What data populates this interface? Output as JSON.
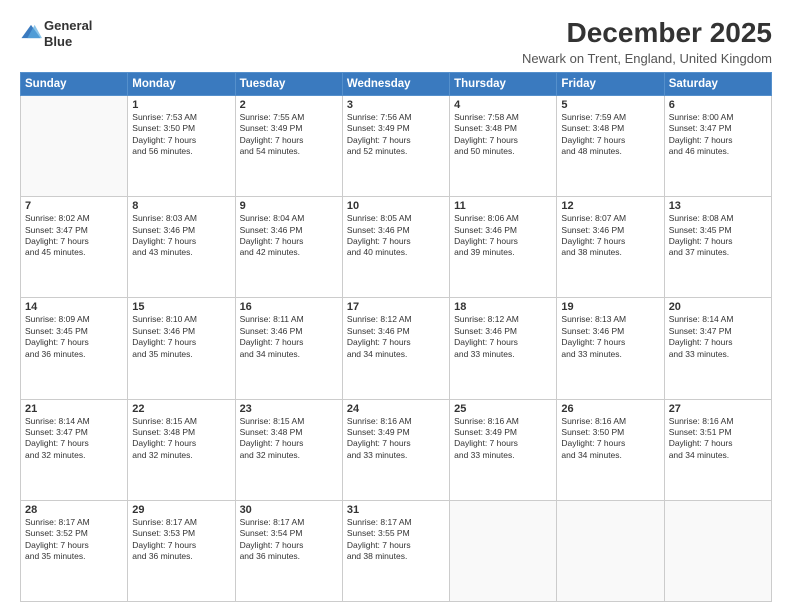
{
  "logo": {
    "line1": "General",
    "line2": "Blue"
  },
  "title": "December 2025",
  "subtitle": "Newark on Trent, England, United Kingdom",
  "days_of_week": [
    "Sunday",
    "Monday",
    "Tuesday",
    "Wednesday",
    "Thursday",
    "Friday",
    "Saturday"
  ],
  "weeks": [
    [
      {
        "day": "",
        "info": ""
      },
      {
        "day": "1",
        "info": "Sunrise: 7:53 AM\nSunset: 3:50 PM\nDaylight: 7 hours\nand 56 minutes."
      },
      {
        "day": "2",
        "info": "Sunrise: 7:55 AM\nSunset: 3:49 PM\nDaylight: 7 hours\nand 54 minutes."
      },
      {
        "day": "3",
        "info": "Sunrise: 7:56 AM\nSunset: 3:49 PM\nDaylight: 7 hours\nand 52 minutes."
      },
      {
        "day": "4",
        "info": "Sunrise: 7:58 AM\nSunset: 3:48 PM\nDaylight: 7 hours\nand 50 minutes."
      },
      {
        "day": "5",
        "info": "Sunrise: 7:59 AM\nSunset: 3:48 PM\nDaylight: 7 hours\nand 48 minutes."
      },
      {
        "day": "6",
        "info": "Sunrise: 8:00 AM\nSunset: 3:47 PM\nDaylight: 7 hours\nand 46 minutes."
      }
    ],
    [
      {
        "day": "7",
        "info": "Sunrise: 8:02 AM\nSunset: 3:47 PM\nDaylight: 7 hours\nand 45 minutes."
      },
      {
        "day": "8",
        "info": "Sunrise: 8:03 AM\nSunset: 3:46 PM\nDaylight: 7 hours\nand 43 minutes."
      },
      {
        "day": "9",
        "info": "Sunrise: 8:04 AM\nSunset: 3:46 PM\nDaylight: 7 hours\nand 42 minutes."
      },
      {
        "day": "10",
        "info": "Sunrise: 8:05 AM\nSunset: 3:46 PM\nDaylight: 7 hours\nand 40 minutes."
      },
      {
        "day": "11",
        "info": "Sunrise: 8:06 AM\nSunset: 3:46 PM\nDaylight: 7 hours\nand 39 minutes."
      },
      {
        "day": "12",
        "info": "Sunrise: 8:07 AM\nSunset: 3:46 PM\nDaylight: 7 hours\nand 38 minutes."
      },
      {
        "day": "13",
        "info": "Sunrise: 8:08 AM\nSunset: 3:45 PM\nDaylight: 7 hours\nand 37 minutes."
      }
    ],
    [
      {
        "day": "14",
        "info": "Sunrise: 8:09 AM\nSunset: 3:45 PM\nDaylight: 7 hours\nand 36 minutes."
      },
      {
        "day": "15",
        "info": "Sunrise: 8:10 AM\nSunset: 3:46 PM\nDaylight: 7 hours\nand 35 minutes."
      },
      {
        "day": "16",
        "info": "Sunrise: 8:11 AM\nSunset: 3:46 PM\nDaylight: 7 hours\nand 34 minutes."
      },
      {
        "day": "17",
        "info": "Sunrise: 8:12 AM\nSunset: 3:46 PM\nDaylight: 7 hours\nand 34 minutes."
      },
      {
        "day": "18",
        "info": "Sunrise: 8:12 AM\nSunset: 3:46 PM\nDaylight: 7 hours\nand 33 minutes."
      },
      {
        "day": "19",
        "info": "Sunrise: 8:13 AM\nSunset: 3:46 PM\nDaylight: 7 hours\nand 33 minutes."
      },
      {
        "day": "20",
        "info": "Sunrise: 8:14 AM\nSunset: 3:47 PM\nDaylight: 7 hours\nand 33 minutes."
      }
    ],
    [
      {
        "day": "21",
        "info": "Sunrise: 8:14 AM\nSunset: 3:47 PM\nDaylight: 7 hours\nand 32 minutes."
      },
      {
        "day": "22",
        "info": "Sunrise: 8:15 AM\nSunset: 3:48 PM\nDaylight: 7 hours\nand 32 minutes."
      },
      {
        "day": "23",
        "info": "Sunrise: 8:15 AM\nSunset: 3:48 PM\nDaylight: 7 hours\nand 32 minutes."
      },
      {
        "day": "24",
        "info": "Sunrise: 8:16 AM\nSunset: 3:49 PM\nDaylight: 7 hours\nand 33 minutes."
      },
      {
        "day": "25",
        "info": "Sunrise: 8:16 AM\nSunset: 3:49 PM\nDaylight: 7 hours\nand 33 minutes."
      },
      {
        "day": "26",
        "info": "Sunrise: 8:16 AM\nSunset: 3:50 PM\nDaylight: 7 hours\nand 34 minutes."
      },
      {
        "day": "27",
        "info": "Sunrise: 8:16 AM\nSunset: 3:51 PM\nDaylight: 7 hours\nand 34 minutes."
      }
    ],
    [
      {
        "day": "28",
        "info": "Sunrise: 8:17 AM\nSunset: 3:52 PM\nDaylight: 7 hours\nand 35 minutes."
      },
      {
        "day": "29",
        "info": "Sunrise: 8:17 AM\nSunset: 3:53 PM\nDaylight: 7 hours\nand 36 minutes."
      },
      {
        "day": "30",
        "info": "Sunrise: 8:17 AM\nSunset: 3:54 PM\nDaylight: 7 hours\nand 36 minutes."
      },
      {
        "day": "31",
        "info": "Sunrise: 8:17 AM\nSunset: 3:55 PM\nDaylight: 7 hours\nand 38 minutes."
      },
      {
        "day": "",
        "info": ""
      },
      {
        "day": "",
        "info": ""
      },
      {
        "day": "",
        "info": ""
      }
    ]
  ]
}
